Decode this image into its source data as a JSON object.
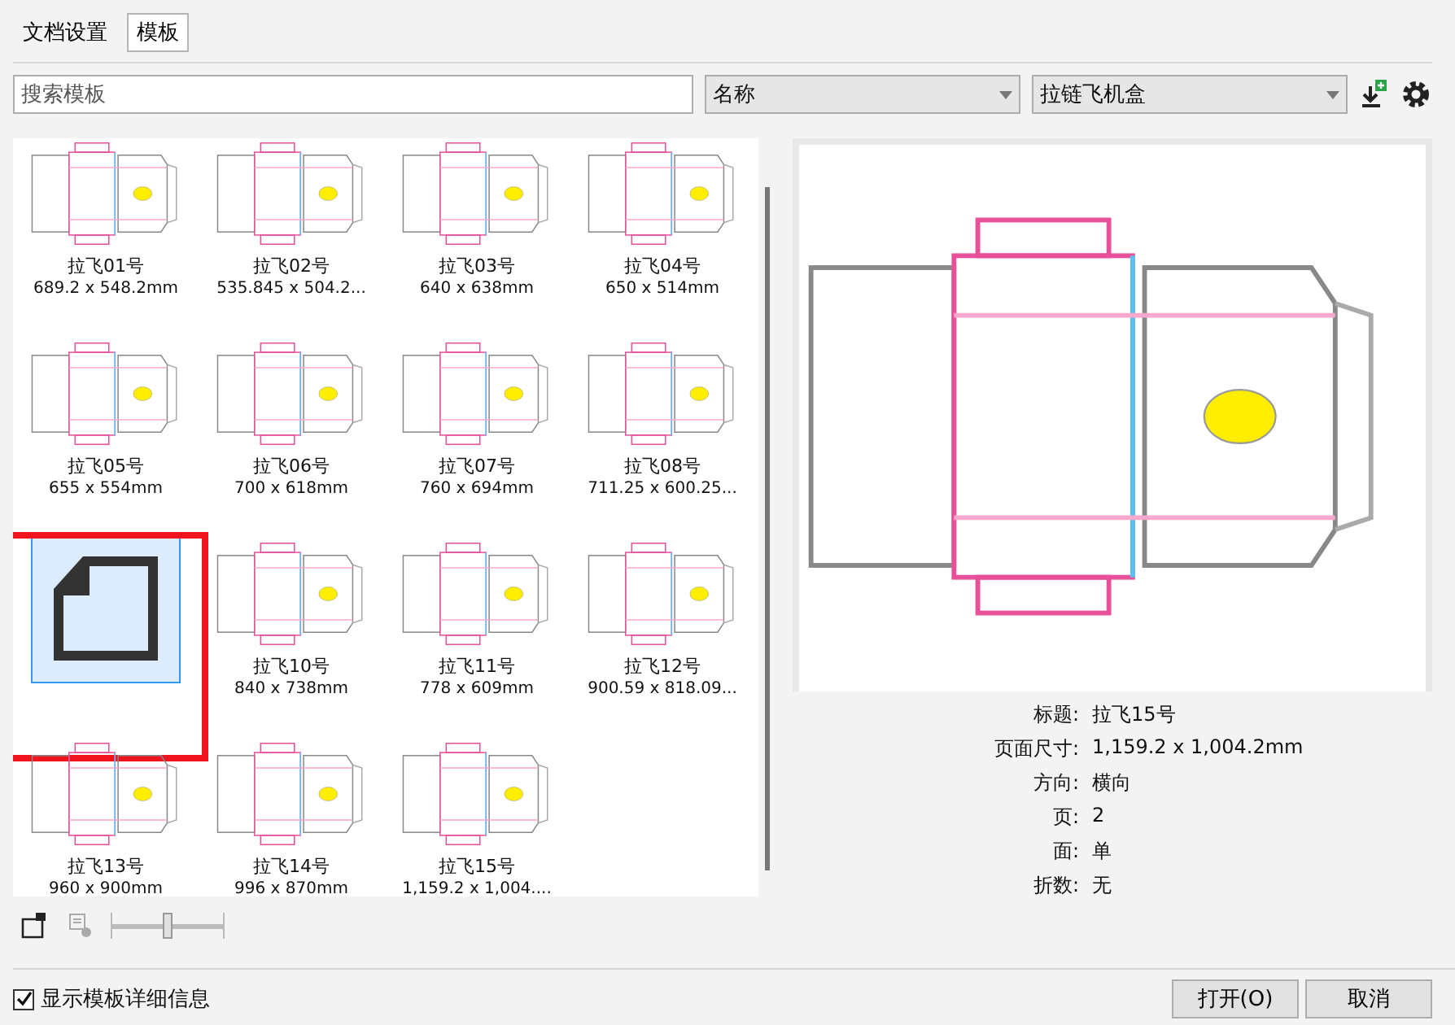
{
  "tabs": [
    {
      "label": "文档设置",
      "selected": false
    },
    {
      "label": "模板",
      "selected": true
    }
  ],
  "search": {
    "placeholder": "搜索模板"
  },
  "sort_select": {
    "value": "名称"
  },
  "category_select": {
    "value": "拉链飞机盒"
  },
  "templates": [
    {
      "kind": "template",
      "name": "拉飞01号",
      "size": "689.2 x 548.2mm",
      "selected": false,
      "highlighted": false
    },
    {
      "kind": "template",
      "name": "拉飞02号",
      "size": "535.845 x 504.2...",
      "selected": false,
      "highlighted": false
    },
    {
      "kind": "template",
      "name": "拉飞03号",
      "size": "640 x 638mm",
      "selected": false,
      "highlighted": false
    },
    {
      "kind": "template",
      "name": "拉飞04号",
      "size": "650 x 514mm",
      "selected": false,
      "highlighted": false
    },
    {
      "kind": "template",
      "name": "拉飞05号",
      "size": "655 x 554mm",
      "selected": false,
      "highlighted": false
    },
    {
      "kind": "template",
      "name": "拉飞06号",
      "size": "700 x 618mm",
      "selected": false,
      "highlighted": false
    },
    {
      "kind": "template",
      "name": "拉飞07号",
      "size": "760 x 694mm",
      "selected": false,
      "highlighted": false
    },
    {
      "kind": "template",
      "name": "拉飞08号",
      "size": "711.25 x 600.25...",
      "selected": false,
      "highlighted": false
    },
    {
      "kind": "blank",
      "selected": true,
      "highlighted": true
    },
    {
      "kind": "template",
      "name": "拉飞10号",
      "size": "840 x 738mm",
      "selected": false,
      "highlighted": false
    },
    {
      "kind": "template",
      "name": "拉飞11号",
      "size": "778 x 609mm",
      "selected": false,
      "highlighted": false
    },
    {
      "kind": "template",
      "name": "拉飞12号",
      "size": "900.59 x 818.09...",
      "selected": false,
      "highlighted": false
    },
    {
      "kind": "template",
      "name": "拉飞13号",
      "size": "960 x 900mm",
      "selected": false,
      "highlighted": false
    },
    {
      "kind": "template",
      "name": "拉飞14号",
      "size": "996 x 870mm",
      "selected": false,
      "highlighted": false
    },
    {
      "kind": "template",
      "name": "拉飞15号",
      "size": "1,159.2 x 1,004....",
      "selected": false,
      "highlighted": false
    }
  ],
  "zoom_slider": {
    "level": 0.5
  },
  "details": [
    {
      "label": "标题:",
      "value": "拉飞15号"
    },
    {
      "label": "页面尺寸:",
      "value": "1,159.2 x 1,004.2mm"
    },
    {
      "label": "方向:",
      "value": "横向"
    },
    {
      "label": "页:",
      "value": "2"
    },
    {
      "label": "面:",
      "value": "单"
    },
    {
      "label": "折数:",
      "value": "无"
    }
  ],
  "show_details": {
    "label": "显示模板详细信息",
    "checked": true
  },
  "buttons": [
    {
      "label": "打开(O)"
    },
    {
      "label": "取消"
    }
  ]
}
